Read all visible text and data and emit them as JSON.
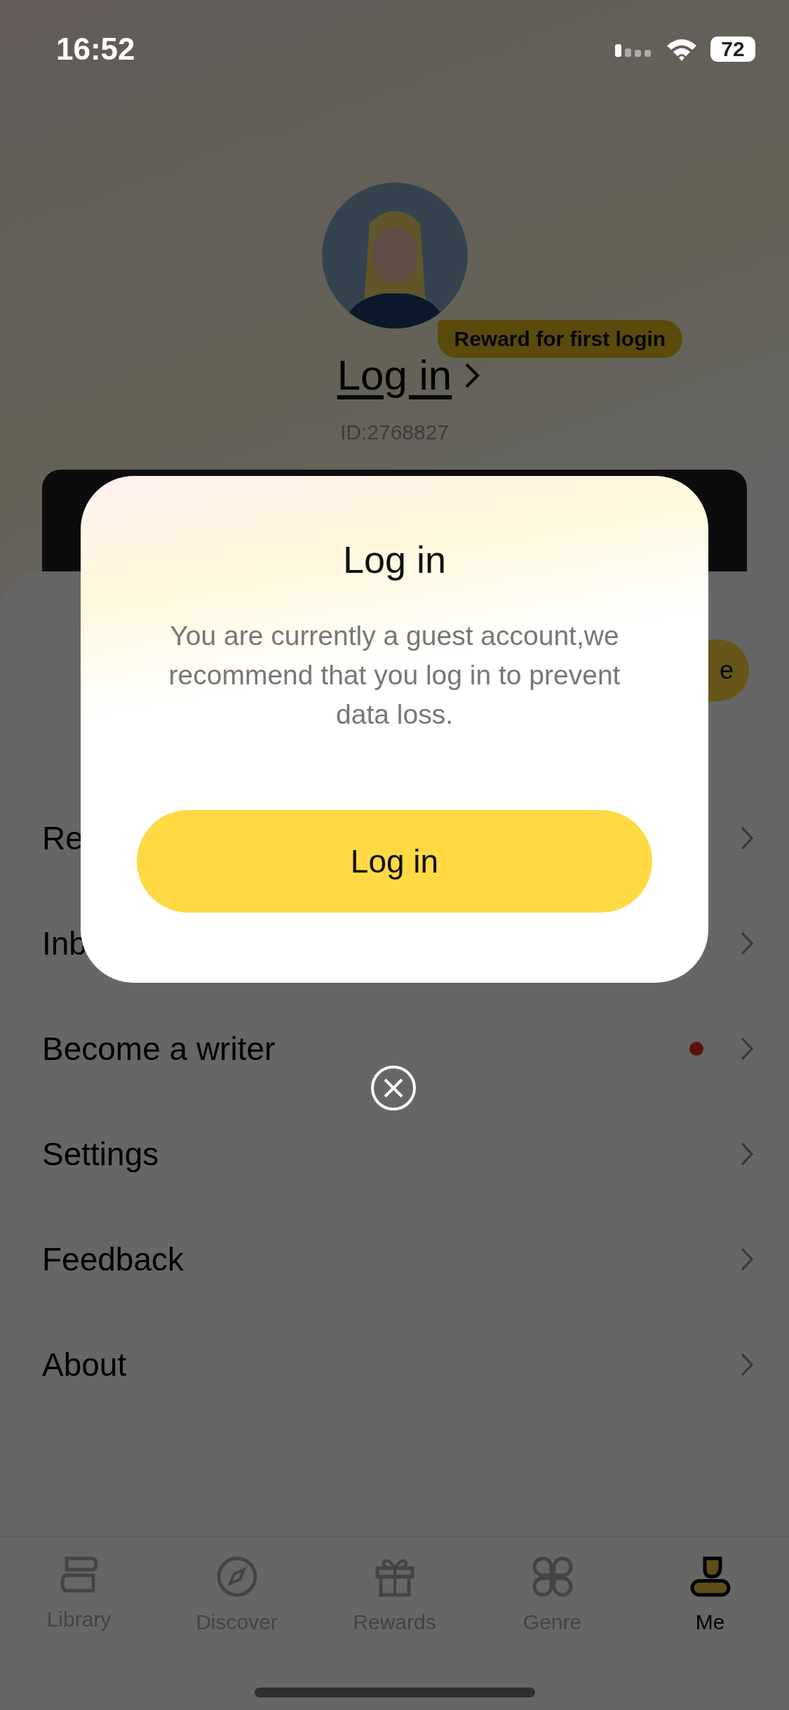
{
  "status_bar": {
    "time": "16:52",
    "battery": "72"
  },
  "profile": {
    "reward_badge": "Reward for first login",
    "login_link": "Log in",
    "id": "ID:2768827"
  },
  "sheet": {
    "partial_button": "e"
  },
  "menu": [
    {
      "label": "Re",
      "dot": false
    },
    {
      "label": "Inb",
      "dot": false
    },
    {
      "label": "Become a writer",
      "dot": true
    },
    {
      "label": "Settings",
      "dot": false
    },
    {
      "label": "Feedback",
      "dot": false
    },
    {
      "label": "About",
      "dot": false
    }
  ],
  "dialog": {
    "title": "Log in",
    "message": "You are currently a guest account,we recommend that you log in to prevent data loss.",
    "button": "Log in"
  },
  "tabs": [
    {
      "label": "Library",
      "selected": false
    },
    {
      "label": "Discover",
      "selected": false
    },
    {
      "label": "Rewards",
      "selected": false
    },
    {
      "label": "Genre",
      "selected": false
    },
    {
      "label": "Me",
      "selected": true
    }
  ]
}
